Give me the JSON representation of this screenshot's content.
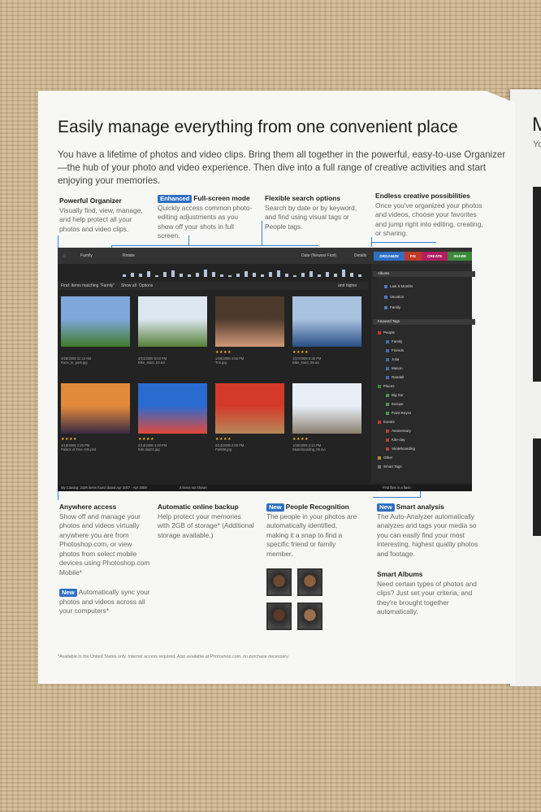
{
  "page": {
    "title": "Easily manage everything from one convenient place",
    "intro": "You have a lifetime of photos and video clips. Bring them all together in the powerful, easy-to-use Organizer—the hub of your photo and video experience. Then dive into a full range of creative activities and start enjoying your memories."
  },
  "features_top": [
    {
      "badge": "",
      "title": "Powerful Organizer",
      "text": "Visually find, view, manage, and help protect all your photos and video clips."
    },
    {
      "badge": "Enhanced",
      "title": "Full-screen mode",
      "text": "Quickly access common photo-editing adjustments as you show off your shots in full screen."
    },
    {
      "badge": "",
      "title": "Flexible search options",
      "text": "Search by date or by keyword, and find using visual tags or People tags."
    },
    {
      "badge": "",
      "title": "Endless creative possibilities",
      "text": "Once you've organized your photos and videos, choose your favorites and jump right into editing, creating, or sharing."
    }
  ],
  "features_bottom": [
    {
      "badge": "",
      "title": "Anywhere access",
      "text": "Show off and manage your photos and videos virtually anywhere you are from Photoshop.com, or view photos from select mobile devices using Photoshop.com Mobile*"
    },
    {
      "badge": "New",
      "title": "",
      "text": "Automatically sync your photos and videos across all your computers*"
    },
    {
      "badge": "",
      "title": "Automatic online backup",
      "text": "Help protect your memories with 2GB of storage* (Additional storage available.)"
    },
    {
      "badge": "New",
      "title": "People Recognition",
      "text": "The people in your photos are automatically identified, making it a snap to find a specific friend or family member."
    },
    {
      "badge": "New",
      "title": "Smart analysis",
      "text": "The Auto-Analyzer automatically analyzes and tags your media so you can easily find your most interesting, highest quality photos and footage."
    },
    {
      "badge": "",
      "title": "Smart Albums",
      "text": "Need certain types of photos and clips? Just set your criteria, and they're brought together automatically."
    }
  ],
  "footnote": "*Available in the United States only. Internet access required. Also available at Photoshop.com, no purchase necessary.",
  "screenshot": {
    "search_text": "Family",
    "rotate_label": "Rotate",
    "sort_label": "Date (Newest First)",
    "details_label": "Details",
    "find_label": "Find: Items matching \"Family\"",
    "show_all": "Show all",
    "options": "Options",
    "higher_label": "and higher",
    "tabs": [
      "ORGANIZE",
      "FIX",
      "CREATE",
      "SHARE"
    ],
    "tab_colors": [
      "#2f6fc4",
      "#c0392b",
      "#b02060",
      "#3a8a3a"
    ],
    "albums_header": "Albums",
    "albums": [
      "Last 6 Months",
      "Vacation",
      "Family"
    ],
    "keyword_header": "Keyword Tags",
    "tags": [
      {
        "name": "People",
        "level": 0,
        "color": "#c0392b"
      },
      {
        "name": "Family",
        "level": 1,
        "color": "#3b6fb0"
      },
      {
        "name": "Friends",
        "level": 1,
        "color": "#3b6fb0"
      },
      {
        "name": "Julia",
        "level": 1,
        "color": "#3b6fb0"
      },
      {
        "name": "Mason",
        "level": 1,
        "color": "#3b6fb0"
      },
      {
        "name": "Randall",
        "level": 1,
        "color": "#3b6fb0"
      },
      {
        "name": "Places",
        "level": 0,
        "color": "#3a8a3a"
      },
      {
        "name": "Big Sur",
        "level": 1,
        "color": "#4a9a4a"
      },
      {
        "name": "Europe",
        "level": 1,
        "color": "#4a9a4a"
      },
      {
        "name": "Point Reyes",
        "level": 1,
        "color": "#4a9a4a"
      },
      {
        "name": "Events",
        "level": 0,
        "color": "#c0392b"
      },
      {
        "name": "Anniversary",
        "level": 1,
        "color": "#b04040"
      },
      {
        "name": "Kite-day",
        "level": 1,
        "color": "#b04040"
      },
      {
        "name": "Skateboarding",
        "level": 1,
        "color": "#b04040"
      },
      {
        "name": "Other",
        "level": 0,
        "color": "#b08a30"
      },
      {
        "name": "Smart Tags",
        "level": 0,
        "color": "#777777"
      }
    ],
    "photos": [
      {
        "stars": "",
        "date": "4/26/2009 11:13 AM",
        "name": "Race_in_park.jpg",
        "c1": "#7fa7d8",
        "c2": "#3f7a2d"
      },
      {
        "stars": "",
        "date": "4/21/2009 5:04 PM",
        "name": "Bike_stunt_02.avi",
        "c1": "#dce6ef",
        "c2": "#57803a"
      },
      {
        "stars": "★★★★",
        "date": "1/26/2009 4:56 PM",
        "name": "Trio.jpg",
        "c1": "#4d3a2c",
        "c2": "#d39a7a"
      },
      {
        "stars": "★★★★",
        "date": "1/27/2009 6:35 PM",
        "name": "Bike_stunt_05.avi",
        "c1": "#a9c2e0",
        "c2": "#2a4f86"
      },
      {
        "stars": "★★★★",
        "date": "1/16/2009 2:20 PM",
        "name": "Palace of Fine Arts.psd",
        "c1": "#e38a3a",
        "c2": "#3a2a44"
      },
      {
        "stars": "★★★★",
        "date": "2/14/2009 4:40 PM",
        "name": "Kite day01.jpg",
        "c1": "#2a6bd0",
        "c2": "#e04a3a"
      },
      {
        "stars": "★★★★",
        "date": "2/14/2009 2:00 PM",
        "name": "Park06.jpg",
        "c1": "#d33a2a",
        "c2": "#b7895a"
      },
      {
        "stars": "★★★★",
        "date": "1/25/2009 2:12 PM",
        "name": "Skateboarding_06.avi",
        "c1": "#e8eef6",
        "c2": "#8a8070"
      }
    ],
    "status_left": "My Catalog: 2426 items found dated Apr 2007 - Apr 2009",
    "status_mid": "5 items not shown",
    "status_right": "Find files in a flash"
  },
  "faces": [
    "#6b4a33",
    "#8a6040",
    "#5a3a28",
    "#9a7050"
  ]
}
